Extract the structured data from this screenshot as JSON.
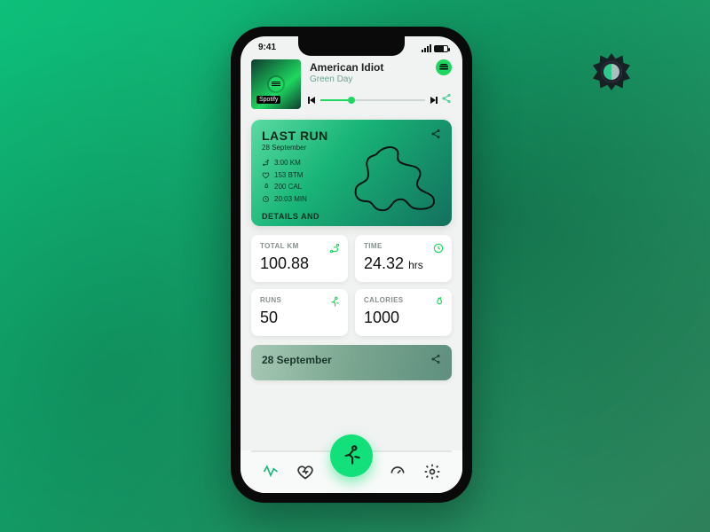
{
  "status": {
    "time": "9:41"
  },
  "music": {
    "service_label": "Spotify",
    "title": "American Idiot",
    "artist": "Green Day"
  },
  "last_run": {
    "heading": "LAST RUN",
    "date": "28 September",
    "distance": "3:00  KM",
    "heart": "153  BTM",
    "calories": "200  CAL",
    "duration": "20:03 MIN",
    "details_label": "DETAILS AND"
  },
  "tiles": {
    "total_km": {
      "label": "TOTAL KM",
      "value": "100.88"
    },
    "time": {
      "label": "TIME",
      "value": "24.32",
      "unit": "hrs"
    },
    "runs": {
      "label": "RUNS",
      "value": "50"
    },
    "calories": {
      "label": "CALORIES",
      "value": "1000"
    }
  },
  "day_card": {
    "title": "28 September"
  }
}
